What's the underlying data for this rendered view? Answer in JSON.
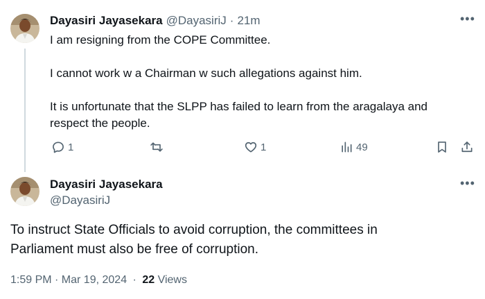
{
  "reply_tweet": {
    "author_name": "Dayasiri Jayasekara",
    "author_handle": "@DayasiriJ",
    "separator": "·",
    "time": "21m",
    "lines": [
      "I am resigning from the COPE Committee.",
      "I cannot work w a Chairman w such allegations against him.",
      "It is unfortunate that the SLPP has failed to learn from the aragalaya and",
      "respect the people."
    ],
    "actions": {
      "reply_count": "1",
      "retweet_count": "",
      "like_count": "1",
      "views_count": "49"
    },
    "more_icon": "more-horizontal-icon"
  },
  "main_tweet": {
    "author_name": "Dayasiri Jayasekara",
    "author_handle": "@DayasiriJ",
    "text_lines": [
      "To instruct State Officials to avoid corruption, the committees in",
      "Parliament must also be free of corruption."
    ],
    "timestamp": "1:59 PM · Mar 19, 2024",
    "meta_separator": "·",
    "views_count": "22",
    "views_label": "Views",
    "more_icon": "more-horizontal-icon"
  },
  "colors": {
    "text": "#0f1419",
    "muted": "#536471",
    "thread_line": "#cfd9de"
  }
}
